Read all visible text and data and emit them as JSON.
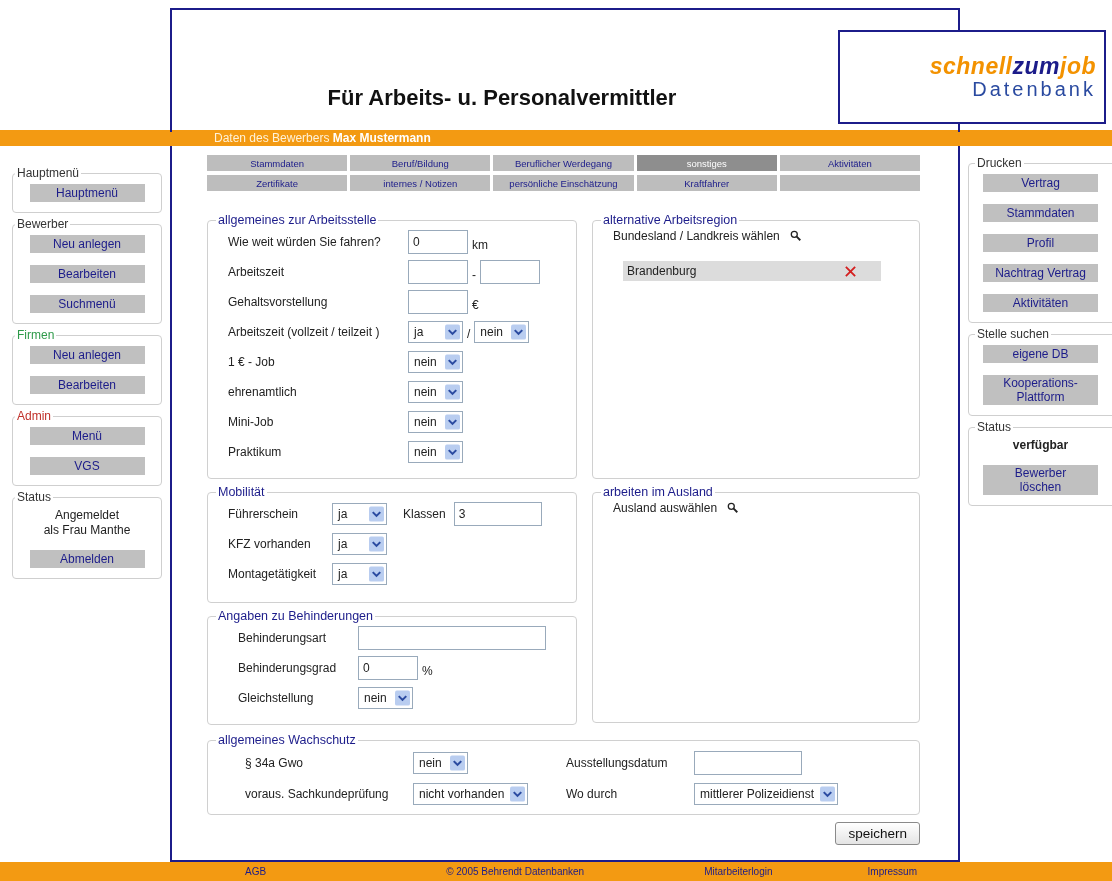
{
  "header": {
    "title": "Für Arbeits- u. Personalvermittler",
    "logo": {
      "word_1": "schnell",
      "word_2": "zum",
      "word_3": "job",
      "subtitle": "Datenbank"
    }
  },
  "applicant_bar": {
    "label": "Daten des Bewerbers",
    "name": "Max Mustermann"
  },
  "tabs": [
    {
      "label": "Stammdaten",
      "selected": false
    },
    {
      "label": "Beruf/Bildung",
      "selected": false
    },
    {
      "label": "Beruflicher Werdegang",
      "selected": false
    },
    {
      "label": "sonstiges",
      "selected": true
    },
    {
      "label": "Aktivitäten",
      "selected": false
    },
    {
      "label": "Zertifikate",
      "selected": false
    },
    {
      "label": "internes / Notizen",
      "selected": false
    },
    {
      "label": "persönliche Einschätzung",
      "selected": false
    },
    {
      "label": "Kraftfahrer",
      "selected": false
    }
  ],
  "left_sidebar": [
    {
      "legend": "Hauptmenü",
      "color": "#333333",
      "items": [
        {
          "kind": "button",
          "label": "Hauptmenü"
        }
      ]
    },
    {
      "legend": "Bewerber",
      "color": "#333333",
      "items": [
        {
          "kind": "button",
          "label": "Neu anlegen"
        },
        {
          "kind": "button",
          "label": "Bearbeiten"
        },
        {
          "kind": "button",
          "label": "Suchmenü"
        }
      ]
    },
    {
      "legend": "Firmen",
      "color": "#2e9a4a",
      "items": [
        {
          "kind": "button",
          "label": "Neu anlegen"
        },
        {
          "kind": "button",
          "label": "Bearbeiten"
        }
      ]
    },
    {
      "legend": "Admin",
      "color": "#c0302a",
      "items": [
        {
          "kind": "button",
          "label": "Menü"
        },
        {
          "kind": "button",
          "label": "VGS"
        }
      ]
    },
    {
      "legend": "Status",
      "color": "#333333",
      "items": [
        {
          "kind": "text",
          "label": "Angemeldet\nals Frau Manthe"
        },
        {
          "kind": "button",
          "label": "Abmelden"
        }
      ]
    }
  ],
  "right_sidebar": [
    {
      "legend": "Drucken",
      "color": "#333333",
      "items": [
        {
          "kind": "button",
          "label": "Vertrag"
        },
        {
          "kind": "button",
          "label": "Stammdaten"
        },
        {
          "kind": "button",
          "label": "Profil"
        },
        {
          "kind": "button",
          "label": "Nachtrag Vertrag"
        },
        {
          "kind": "button",
          "label": "Aktivitäten"
        }
      ]
    },
    {
      "legend": "Stelle suchen",
      "color": "#333333",
      "items": [
        {
          "kind": "button",
          "label": "eigene DB"
        },
        {
          "kind": "button",
          "label": "Kooperations-\nPlattform"
        }
      ]
    },
    {
      "legend": "Status",
      "color": "#333333",
      "items": [
        {
          "kind": "bold_text",
          "label": "verfügbar"
        },
        {
          "kind": "button",
          "label": "Bewerber\nlöschen"
        }
      ]
    }
  ],
  "workplace": {
    "title": "allgemeines zur Arbeitsstelle",
    "rows": [
      {
        "label": "Wie weit würden Sie fahren?",
        "controls": [
          {
            "kind": "input",
            "value": "0"
          },
          {
            "kind": "text",
            "text": "km"
          }
        ]
      },
      {
        "label": "Arbeitszeit",
        "controls": [
          {
            "kind": "input"
          },
          {
            "kind": "text",
            "text": "-"
          },
          {
            "kind": "input"
          }
        ]
      },
      {
        "label": "Gehaltsvorstellung",
        "controls": [
          {
            "kind": "input"
          },
          {
            "kind": "text",
            "text": "€"
          }
        ]
      },
      {
        "label": "Arbeitszeit (vollzeit / teilzeit )",
        "controls": [
          {
            "kind": "select",
            "value": "ja"
          },
          {
            "kind": "text",
            "text": "/"
          },
          {
            "kind": "select",
            "value": "nein"
          }
        ]
      },
      {
        "label": "1 € - Job",
        "controls": [
          {
            "kind": "select",
            "value": "nein"
          }
        ]
      },
      {
        "label": "ehrenamtlich",
        "controls": [
          {
            "kind": "select",
            "value": "nein"
          }
        ]
      },
      {
        "label": "Mini-Job",
        "controls": [
          {
            "kind": "select",
            "value": "nein"
          }
        ]
      },
      {
        "label": "Praktikum",
        "controls": [
          {
            "kind": "select",
            "value": "nein"
          }
        ]
      }
    ]
  },
  "alternative_region": {
    "title": "alternative Arbeitsregion",
    "prompt": "Bundesland / Landkreis wählen",
    "items": [
      "Brandenburg"
    ]
  },
  "mobility": {
    "title": "Mobilität",
    "rows": [
      {
        "label": "Führerschein",
        "controls": [
          {
            "kind": "select",
            "value": "ja"
          },
          {
            "kind": "text",
            "text": "Klassen"
          },
          {
            "kind": "wide_input",
            "value": "3"
          }
        ]
      },
      {
        "label": "KFZ vorhanden",
        "controls": [
          {
            "kind": "select",
            "value": "ja"
          }
        ]
      },
      {
        "label": "Montagetätigkeit",
        "controls": [
          {
            "kind": "select",
            "value": "ja"
          }
        ]
      }
    ]
  },
  "abroad": {
    "title": "arbeiten im Ausland",
    "prompt": "Ausland auswählen"
  },
  "disability": {
    "title": "Angaben zu Behinderungen",
    "rows": [
      {
        "label": "Behinderungsart",
        "controls": [
          {
            "kind": "long_input"
          }
        ]
      },
      {
        "label": "Behinderungsgrad",
        "controls": [
          {
            "kind": "input",
            "value": "0"
          },
          {
            "kind": "text",
            "text": "%"
          }
        ]
      },
      {
        "label": "Gleichstellung",
        "controls": [
          {
            "kind": "select",
            "value": "nein"
          }
        ]
      }
    ]
  },
  "security": {
    "title": "allgemeines Wachschutz",
    "fields": [
      {
        "label": "§ 34a Gwo",
        "controls": [
          {
            "kind": "select",
            "value": "nein"
          }
        ]
      },
      {
        "label": "Ausstellungsdatum",
        "controls": [
          {
            "kind": "wide_input"
          }
        ]
      },
      {
        "label": "voraus. Sachkundeprüfung",
        "controls": [
          {
            "kind": "select",
            "value": "nicht vorhanden"
          }
        ]
      },
      {
        "label": "Wo durch",
        "controls": [
          {
            "kind": "select",
            "value": "mittlerer Polizeidienst"
          }
        ]
      }
    ]
  },
  "save_button": "speichern",
  "footer": [
    "AGB",
    "© 2005 Behrendt Datenbanken",
    "Mitarbeiterlogin",
    "Impressum"
  ]
}
